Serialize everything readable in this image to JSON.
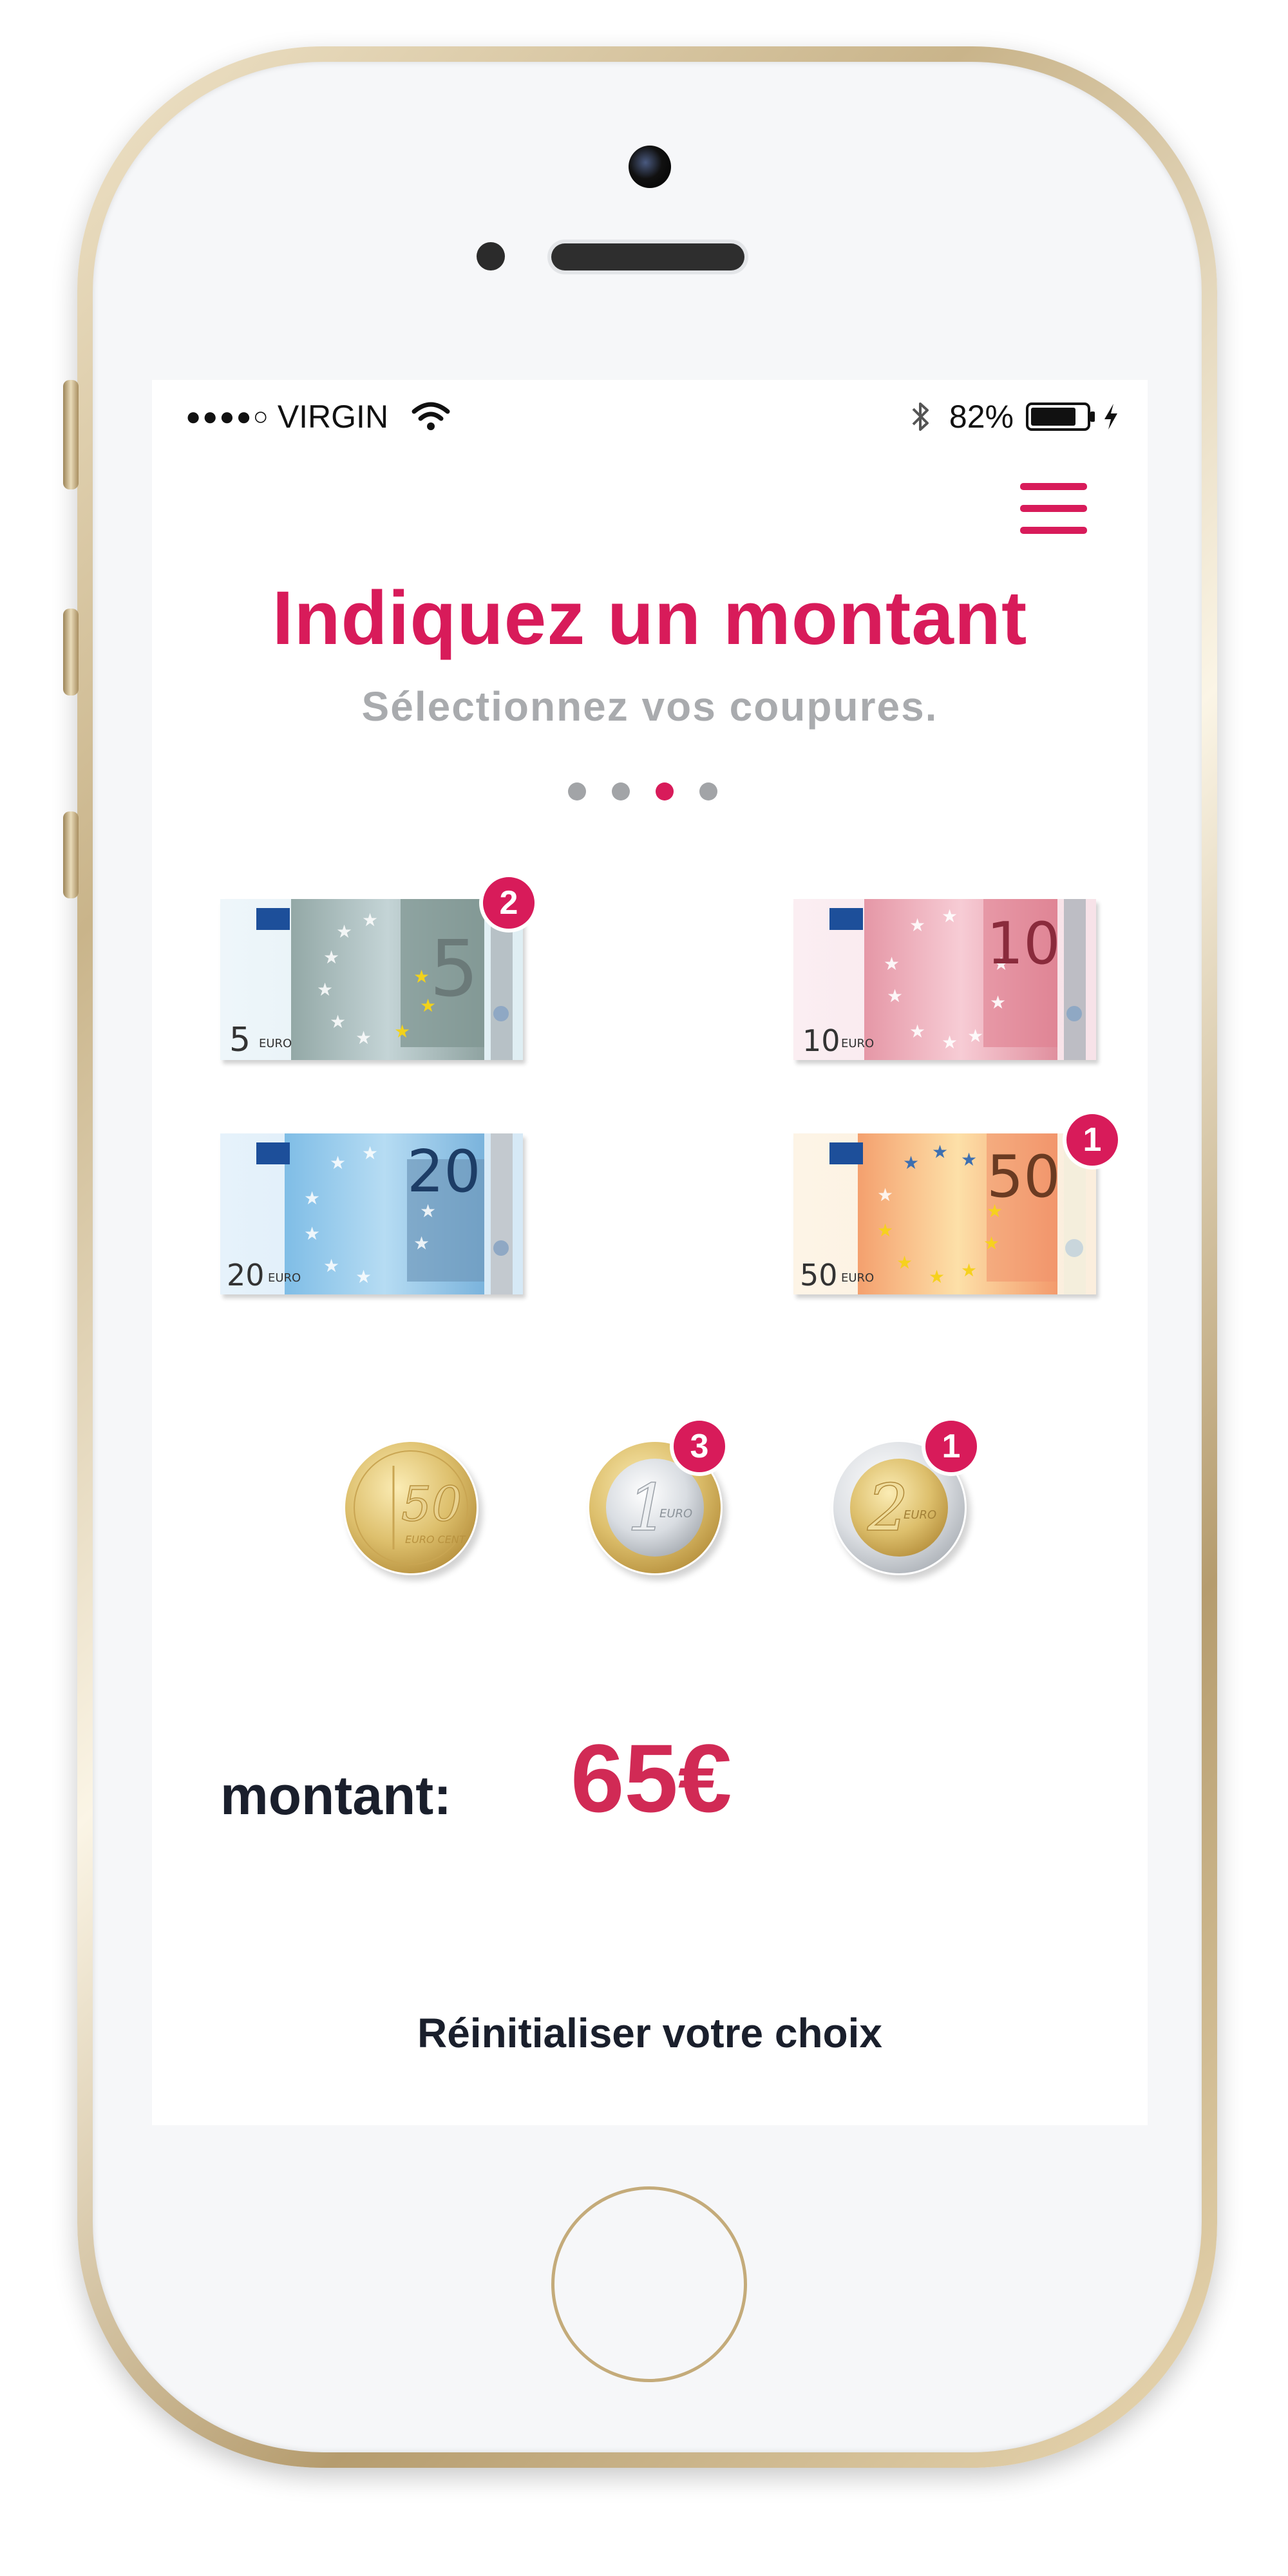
{
  "status_bar": {
    "signal": "●●●●○",
    "carrier": "VIRGIN",
    "battery_percent": "82%",
    "battery_level": 0.82
  },
  "header": {
    "title": "Indiquez un montant",
    "subtitle": "Sélectionnez vos coupures."
  },
  "pager": {
    "count": 4,
    "active_index": 2
  },
  "banknotes": [
    {
      "value": "5",
      "euro": "EURO",
      "badge": "2",
      "color": "#9fb3b0"
    },
    {
      "value": "10",
      "euro": "EURO",
      "badge": "",
      "color": "#e8a4b0"
    },
    {
      "value": "20",
      "euro": "EURO",
      "badge": "",
      "color": "#8ec3e6"
    },
    {
      "value": "50",
      "euro": "EURO",
      "badge": "1",
      "color": "#f2a679"
    }
  ],
  "coins": [
    {
      "value": "50",
      "mark": "EURO CENT",
      "badge": ""
    },
    {
      "value": "1",
      "mark": "EURO",
      "badge": "3"
    },
    {
      "value": "2",
      "mark": "EURO",
      "badge": "1"
    }
  ],
  "amount": {
    "label": "montant:",
    "value": "65€"
  },
  "reset": {
    "label": "Réinitialiser votre choix"
  },
  "colors": {
    "accent": "#d81b5a",
    "amount": "#d12a55",
    "subtitle": "#a9abae",
    "text": "#1a1f2c"
  }
}
